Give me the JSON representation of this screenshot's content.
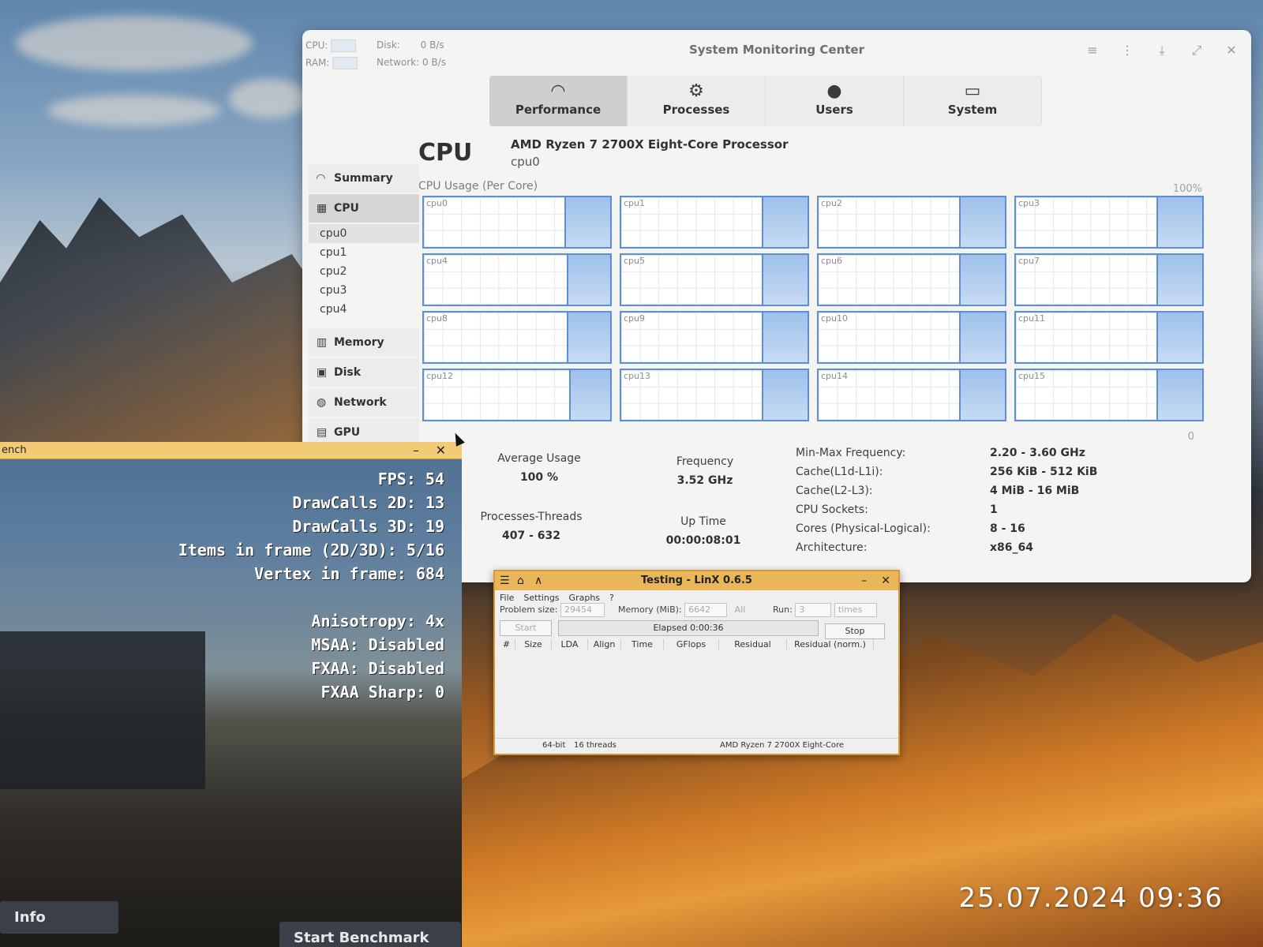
{
  "smc": {
    "title": "System Monitoring Center",
    "mini": {
      "cpu_label": "CPU:",
      "ram_label": "RAM:",
      "disk_label": "Disk:",
      "disk_value": "0 B/s",
      "network_label": "Network:",
      "network_value": "0 B/s"
    },
    "tabs": [
      {
        "label": "Performance",
        "icon": "gauge-icon",
        "active": true
      },
      {
        "label": "Processes",
        "icon": "gear-icon",
        "active": false
      },
      {
        "label": "Users",
        "icon": "mouse-icon",
        "active": false
      },
      {
        "label": "System",
        "icon": "monitor-icon",
        "active": false
      }
    ],
    "sidebar": {
      "summary": "Summary",
      "cpu": "CPU",
      "cores": [
        "cpu0",
        "cpu1",
        "cpu2",
        "cpu3",
        "cpu4"
      ],
      "memory": "Memory",
      "disk": "Disk",
      "network": "Network",
      "gpu": "GPU"
    },
    "heading": "CPU",
    "processor": "AMD Ryzen 7 2700X Eight-Core Processor",
    "selected_core": "cpu0",
    "usage_label": "CPU Usage (Per Core)",
    "axis_max": "100%",
    "axis_min": "0",
    "cores": [
      "cpu0",
      "cpu1",
      "cpu2",
      "cpu3",
      "cpu4",
      "cpu5",
      "cpu6",
      "cpu7",
      "cpu8",
      "cpu9",
      "cpu10",
      "cpu11",
      "cpu12",
      "cpu13",
      "cpu14",
      "cpu15"
    ],
    "stats": {
      "avg_usage_label": "Average Usage",
      "avg_usage": "100 %",
      "frequency_label": "Frequency",
      "frequency": "3.52 GHz",
      "proc_threads_label": "Processes-Threads",
      "proc_threads": "407 - 632",
      "uptime_label": "Up Time",
      "uptime": "00:00:08:01"
    },
    "details": [
      {
        "k": "Min-Max Frequency:",
        "v": "2.20 - 3.60 GHz"
      },
      {
        "k": "Cache(L1d-L1i):",
        "v": "256 KiB - 512 KiB"
      },
      {
        "k": "Cache(L2-L3):",
        "v": "4 MiB - 16 MiB"
      },
      {
        "k": "CPU Sockets:",
        "v": "1"
      },
      {
        "k": "Cores (Physical-Logical):",
        "v": "8 - 16"
      },
      {
        "k": "Architecture:",
        "v": "x86_64"
      }
    ]
  },
  "bench": {
    "title": "ench",
    "lines": [
      "FPS: 54",
      "DrawCalls 2D: 13",
      "DrawCalls 3D: 19",
      "Items in frame (2D/3D): 5/16",
      "Vertex in frame: 684",
      "",
      "Anisotropy: 4x",
      "MSAA: Disabled",
      "FXAA: Disabled",
      "FXAA Sharp: 0"
    ],
    "info_button": "Info",
    "start_button": "Start Benchmark"
  },
  "linx": {
    "title": "Testing - LinX 0.6.5",
    "menu": [
      "File",
      "Settings",
      "Graphs",
      "?"
    ],
    "problem_size_label": "Problem size:",
    "problem_size": "29454",
    "memory_label": "Memory (MiB):",
    "memory": "6642",
    "all_label": "All",
    "run_label": "Run:",
    "run": "3",
    "run_unit": "times",
    "start": "Start",
    "elapsed": "Elapsed 0:00:36",
    "stop": "Stop",
    "columns": [
      "#",
      "Size",
      "LDA",
      "Align",
      "Time",
      "GFlops",
      "Residual",
      "Residual (norm.)"
    ],
    "status": {
      "bits": "64-bit",
      "threads": "16 threads",
      "cpu": "AMD Ryzen 7 2700X Eight-Core"
    }
  },
  "timestamp": "25.07.2024 09:36",
  "colors": {
    "graph_line": "#5c8fd6",
    "graph_fill": "#9ec0ea",
    "bench_titlebar": "#f3cb75",
    "linx_titlebar": "#e9b65a"
  }
}
